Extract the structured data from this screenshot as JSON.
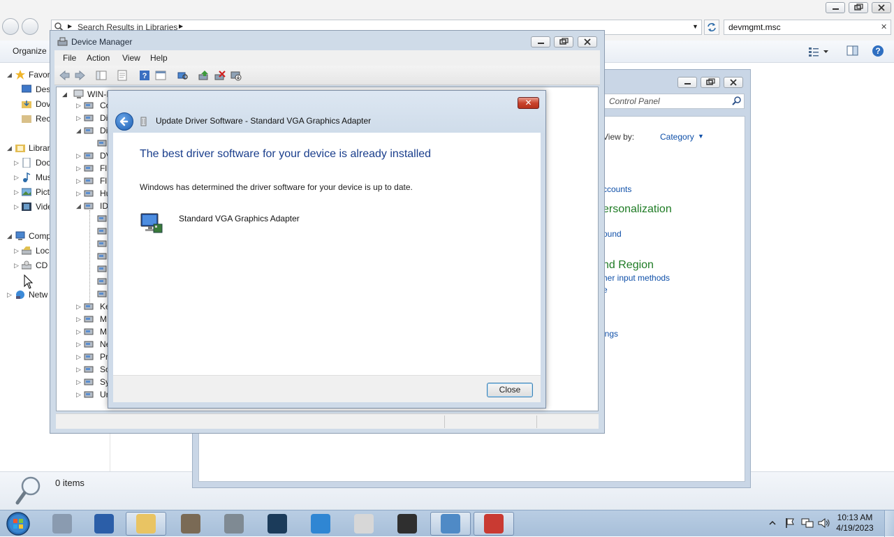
{
  "explorer": {
    "breadcrumb": "Search Results in Libraries",
    "search_value": "devmgmt.msc",
    "organize": "Organize",
    "status_items": "0 items",
    "nav": [
      {
        "label": "Favor",
        "key": "favorites"
      },
      {
        "label": "Des",
        "key": "desktop"
      },
      {
        "label": "Dov",
        "key": "downloads"
      },
      {
        "label": "Rec",
        "key": "recent"
      },
      {
        "label": "Librar",
        "key": "libraries"
      },
      {
        "label": "Doc",
        "key": "documents"
      },
      {
        "label": "Mus",
        "key": "music"
      },
      {
        "label": "Pict",
        "key": "pictures"
      },
      {
        "label": "Vide",
        "key": "videos"
      },
      {
        "label": "Comp",
        "key": "computer"
      },
      {
        "label": "Loc",
        "key": "local-disk"
      },
      {
        "label": "CD",
        "key": "cd-drive"
      },
      {
        "label": "Netw",
        "key": "network"
      }
    ]
  },
  "control_panel": {
    "search_placeholder": "Control Panel",
    "view_by_label": "View by:",
    "view_by_value": "Category",
    "links": {
      "accounts": "ccounts",
      "personalization": "ersonalization",
      "sound": "ound",
      "region": "nd Region",
      "input": "her input methods",
      "e": "e",
      "settings": "ings"
    }
  },
  "device_manager": {
    "title": "Device Manager",
    "menus": [
      "File",
      "Action",
      "View",
      "Help"
    ],
    "tree_root": "WIN-I",
    "tree": [
      "Co",
      "Di",
      "Di",
      "",
      "DV",
      "Fl",
      "Fl",
      "Hu",
      "ID",
      "",
      "",
      "",
      "",
      "",
      "",
      "",
      "Ke",
      "M",
      "M",
      "Ne",
      "Pr",
      "So",
      "Sy",
      "Ur"
    ]
  },
  "dialog": {
    "title": "Update Driver Software - Standard VGA Graphics Adapter",
    "heading": "The best driver software for your device is already installed",
    "message": "Windows has determined the driver software for your device is up to date.",
    "device_name": "Standard VGA Graphics Adapter",
    "close_button": "Close",
    "close_x": "✕"
  },
  "taskbar": {
    "time": "10:13 AM",
    "date": "4/19/2023",
    "items": [
      {
        "name": "device-manager-icon",
        "color": "#8a9bb0"
      },
      {
        "name": "powershell-icon",
        "color": "#2b5ea8"
      },
      {
        "name": "file-explorer-icon",
        "color": "#e9c463"
      },
      {
        "name": "raccoon-app-icon",
        "color": "#7a6a55"
      },
      {
        "name": "update-app-icon",
        "color": "#7f8a93"
      },
      {
        "name": "steam-icon",
        "color": "#1b3b5a"
      },
      {
        "name": "internet-explorer-icon",
        "color": "#2f86d3"
      },
      {
        "name": "notepad-icon",
        "color": "#d7d7d7"
      },
      {
        "name": "obs-icon",
        "color": "#2f2f2f"
      },
      {
        "name": "control-panel-icon",
        "color": "#4f8ac6"
      },
      {
        "name": "toolbox-icon",
        "color": "#c93a32"
      }
    ]
  }
}
